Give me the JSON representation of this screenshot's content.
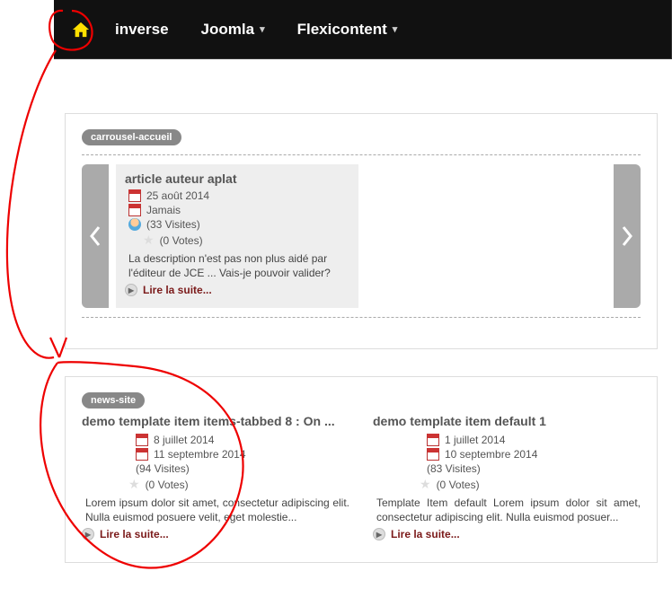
{
  "nav": {
    "items": [
      {
        "label": "inverse",
        "dropdown": false
      },
      {
        "label": "Joomla",
        "dropdown": true
      },
      {
        "label": "Flexicontent",
        "dropdown": true
      }
    ]
  },
  "carouselPanel": {
    "badge": "carrousel-accueil",
    "item": {
      "title": "article auteur aplat",
      "date1": "25 août 2014",
      "date2": "Jamais",
      "visits": "(33 Visites)",
      "votes": "(0 Votes)",
      "desc": "La description n'est pas non plus aidé par l'éditeur de JCE ... Vais-je pouvoir valider?",
      "readmore": "Lire la suite..."
    }
  },
  "newsPanel": {
    "badge": "news-site",
    "left": {
      "title": "demo template item items-tabbed 8 : On ...",
      "date1": "8 juillet 2014",
      "date2": "11 septembre 2014",
      "visits": "(94 Visites)",
      "votes": "(0 Votes)",
      "desc": "Lorem ipsum dolor sit amet, consectetur adipiscing elit. Nulla euismod posuere velit, eget molestie...",
      "readmore": "Lire la suite..."
    },
    "right": {
      "title": "demo template item default 1",
      "date1": "1 juillet 2014",
      "date2": "10 septembre 2014",
      "visits": "(83 Visites)",
      "votes": "(0 Votes)",
      "desc": "Template Item default Lorem ipsum dolor sit amet, consectetur adipiscing elit. Nulla euismod posuer...",
      "readmore": "Lire la suite..."
    }
  }
}
